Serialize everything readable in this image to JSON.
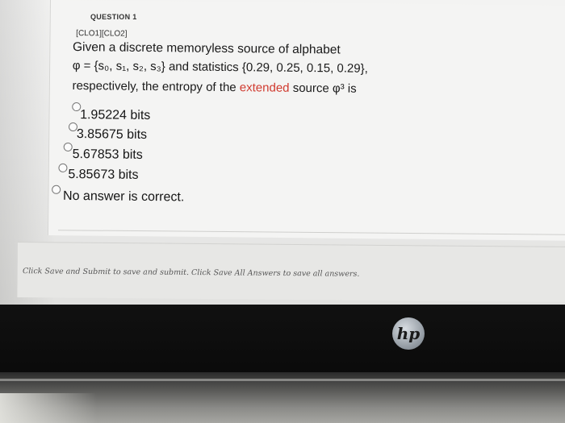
{
  "question": {
    "number_label": "QUESTION 1",
    "clo_tag": "[CLO1][CLO2]",
    "line1": "Given a discrete memoryless source of alphabet",
    "line2": "φ = {s₀, s₁, s₂, s₃} and statistics {0.29, 0.25, 0.15, 0.29},",
    "line3_before": "respectively, the entropy of the ",
    "line3_highlight": "extended",
    "line3_after": " source φ³ is",
    "highlight_color": "#d03a2f"
  },
  "options": [
    {
      "label": "1.95224 bits",
      "selected": false
    },
    {
      "label": "3.85675 bits",
      "selected": false
    },
    {
      "label": "5.67853 bits",
      "selected": false
    },
    {
      "label": "5.85673 bits",
      "selected": false
    },
    {
      "label": "No answer is correct.",
      "selected": false
    }
  ],
  "footer": {
    "instruction": "Click Save and Submit to save and submit. Click Save All Answers to save all answers."
  },
  "device": {
    "logo_text": "hp"
  }
}
